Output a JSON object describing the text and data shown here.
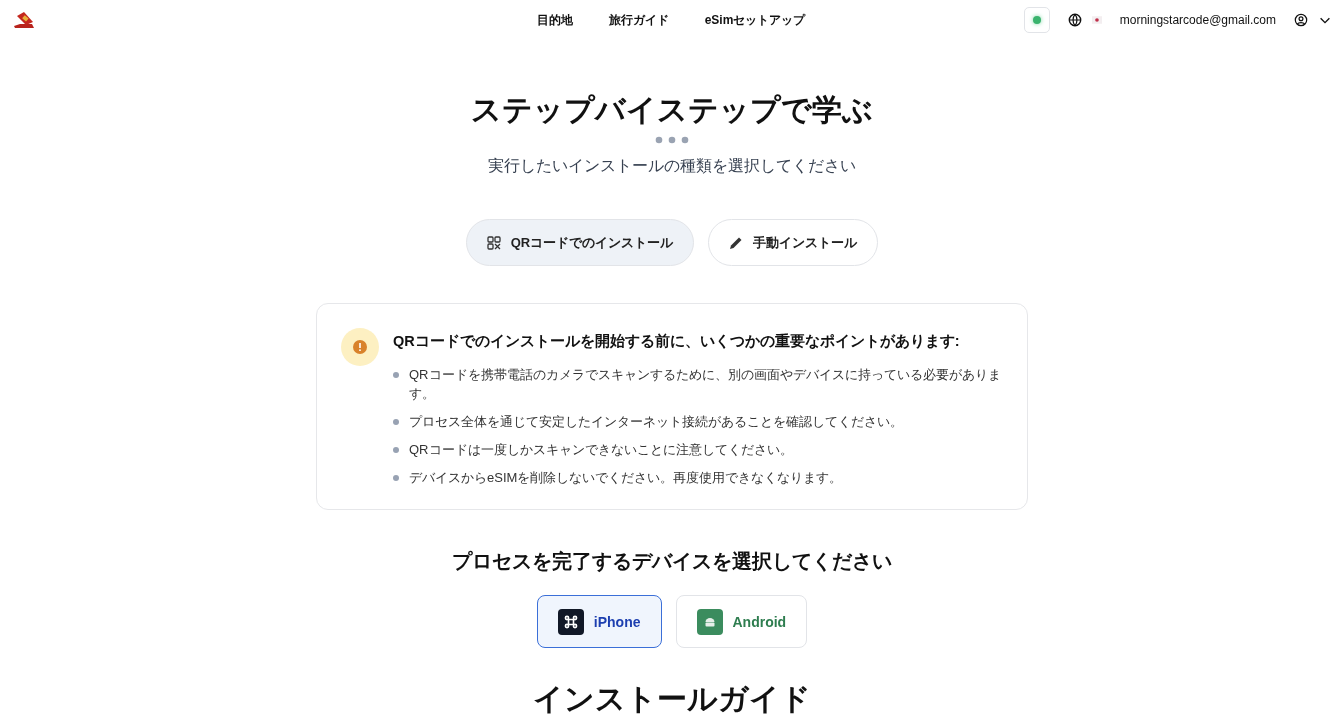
{
  "nav": {
    "links": [
      "目的地",
      "旅行ガイド",
      "eSimセットアップ"
    ],
    "status_on": true,
    "email": "morningstarcode@gmail.com"
  },
  "hero": {
    "title": "ステップバイステップで学ぶ",
    "subtitle": "実行したいインストールの種類を選択してください"
  },
  "install_tabs": [
    {
      "label": "QRコードでのインストール",
      "kind": "qr",
      "selected": true
    },
    {
      "label": "手動インストール",
      "kind": "manual",
      "selected": false
    }
  ],
  "notice": {
    "title": "QRコードでのインストールを開始する前に、いくつかの重要なポイントがあります:",
    "points": [
      "QRコードを携帯電話のカメラでスキャンするために、別の画面やデバイスに持っている必要があります。",
      "プロセス全体を通じて安定したインターネット接続があることを確認してください。",
      "QRコードは一度しかスキャンできないことに注意してください。",
      "デバイスからeSIMを削除しないでください。再度使用できなくなります。"
    ]
  },
  "device_heading": "プロセスを完了するデバイスを選択してください",
  "devices": [
    {
      "label": "iPhone",
      "kind": "apple",
      "selected": true
    },
    {
      "label": "Android",
      "kind": "android",
      "selected": false
    }
  ],
  "guide_heading": "インストールガイド"
}
